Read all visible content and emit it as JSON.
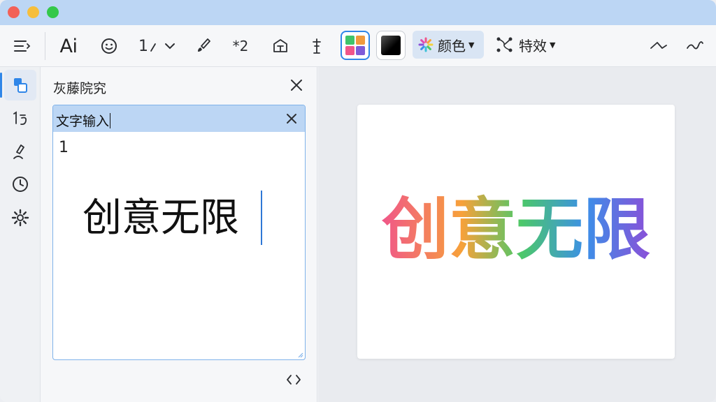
{
  "toolbar": {
    "ai_label": "Ai",
    "size_label": "1",
    "superscript_label": "*2",
    "color_label": "颜色",
    "effects_label": "特效"
  },
  "rail": {
    "items": [
      "layers",
      "text-size",
      "draw",
      "history",
      "settings"
    ]
  },
  "panel": {
    "title": "灰藤院究",
    "editor": {
      "header_label": "文字输入",
      "line_number": "1",
      "text": "创意无限"
    }
  },
  "preview": {
    "text": "创意无限",
    "gradient": [
      "#f0568a",
      "#f7a13a",
      "#4cc869",
      "#3c8fe8",
      "#8b4fd8"
    ]
  },
  "colors": {
    "accent": "#2f86e8",
    "titlebar": "#bcd6f4"
  }
}
